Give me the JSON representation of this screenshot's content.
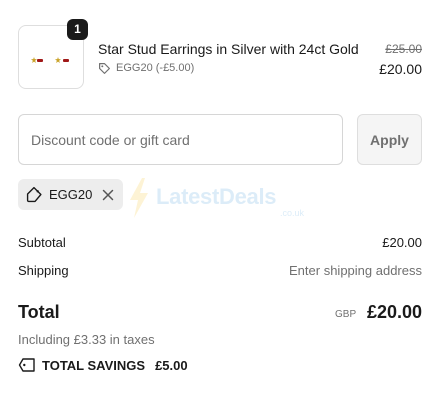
{
  "product": {
    "quantity": "1",
    "name": "Star Stud Earrings in Silver with 24ct Gold",
    "discount_label": "EGG20 (-£5.00)",
    "original_price": "£25.00",
    "price": "£20.00"
  },
  "discount_form": {
    "placeholder": "Discount code or gift card",
    "value": "",
    "apply_label": "Apply"
  },
  "applied_code": {
    "code": "EGG20"
  },
  "watermark": {
    "text": "LatestDeals",
    "sub": ".co.uk"
  },
  "summary": {
    "subtotal_label": "Subtotal",
    "subtotal_value": "£20.00",
    "shipping_label": "Shipping",
    "shipping_value": "Enter shipping address",
    "total_label": "Total",
    "currency": "GBP",
    "total_value": "£20.00",
    "taxes_text": "Including £3.33 in taxes",
    "savings_label": "TOTAL SAVINGS",
    "savings_value": "£5.00"
  },
  "icons": {
    "tag": "tag-icon",
    "close": "close-icon",
    "bolt": "bolt-icon"
  }
}
